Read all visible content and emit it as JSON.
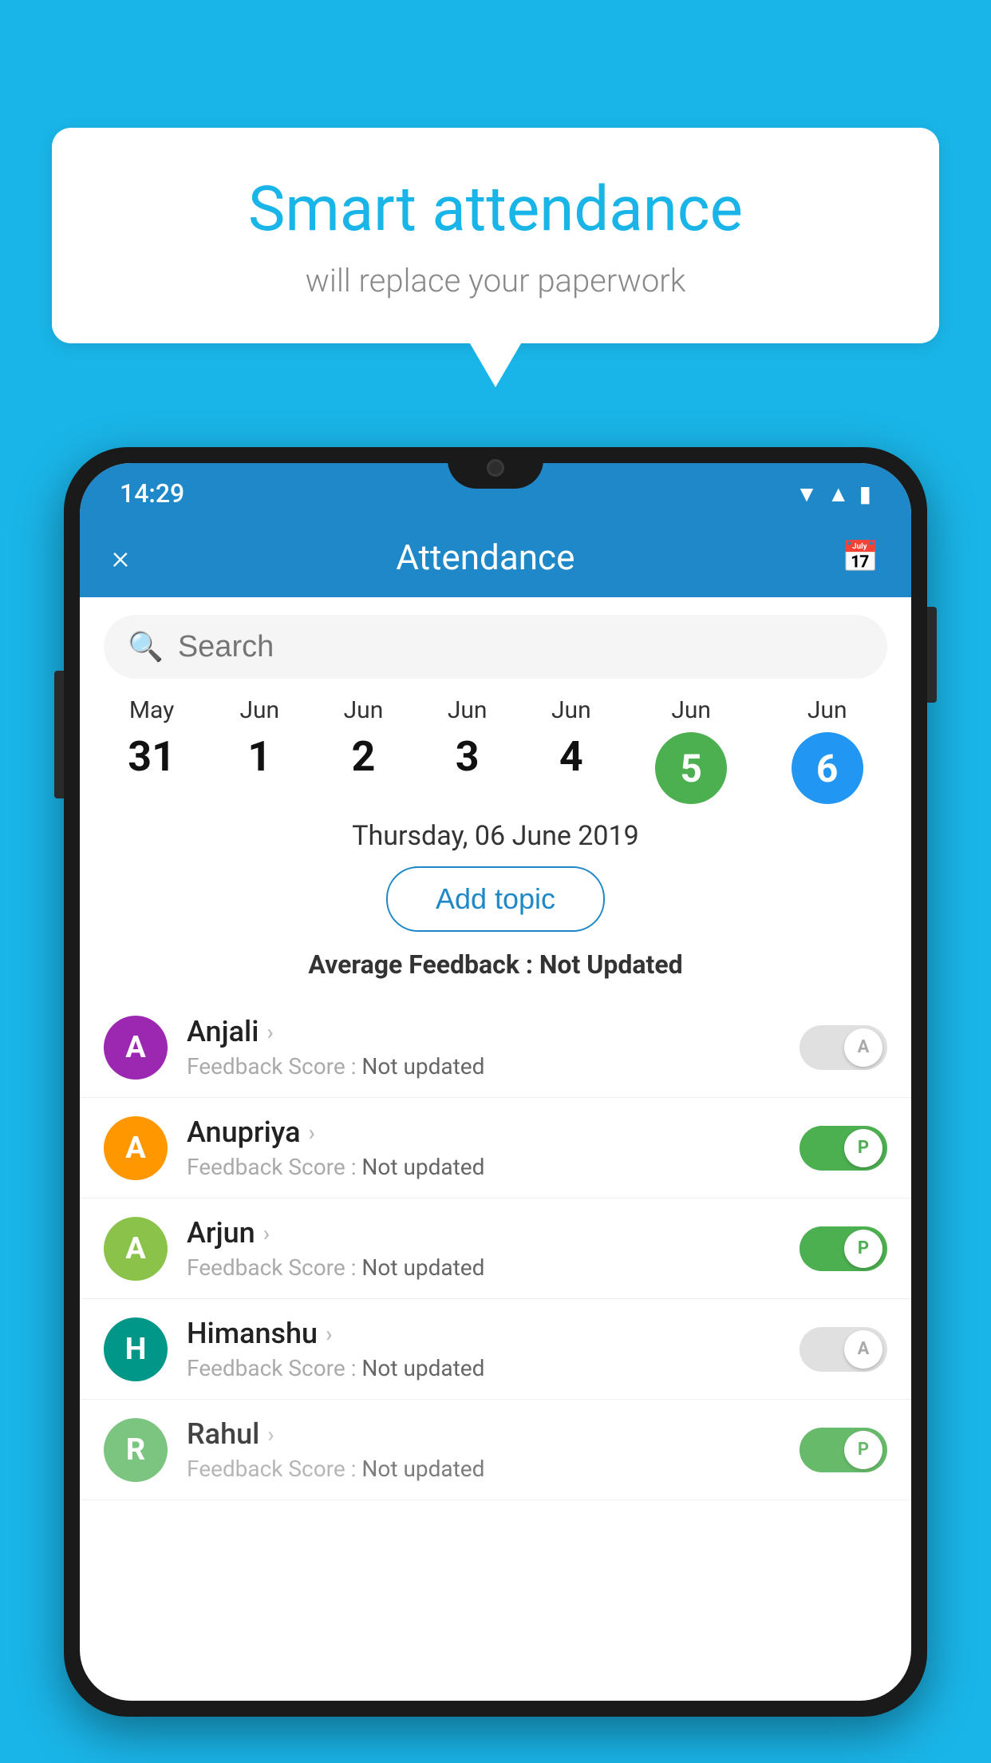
{
  "background_color": "#1ab5e8",
  "speech_bubble": {
    "title": "Smart attendance",
    "subtitle": "will replace your paperwork"
  },
  "status_bar": {
    "time": "14:29",
    "icons": [
      "wifi",
      "signal",
      "battery"
    ]
  },
  "header": {
    "title": "Attendance",
    "close_label": "×",
    "calendar_icon": "calendar"
  },
  "search": {
    "placeholder": "Search"
  },
  "dates": [
    {
      "month": "May",
      "day": "31",
      "type": "plain"
    },
    {
      "month": "Jun",
      "day": "1",
      "type": "plain"
    },
    {
      "month": "Jun",
      "day": "2",
      "type": "plain"
    },
    {
      "month": "Jun",
      "day": "3",
      "type": "plain"
    },
    {
      "month": "Jun",
      "day": "4",
      "type": "plain"
    },
    {
      "month": "Jun",
      "day": "5",
      "type": "green"
    },
    {
      "month": "Jun",
      "day": "6",
      "type": "blue"
    }
  ],
  "selected_date": "Thursday, 06 June 2019",
  "add_topic_label": "Add topic",
  "avg_feedback": {
    "label": "Average Feedback :",
    "value": "Not Updated"
  },
  "students": [
    {
      "name": "Anjali",
      "initial": "A",
      "avatar_color": "purple",
      "feedback_label": "Feedback Score :",
      "feedback_value": "Not updated",
      "toggle": "off",
      "toggle_letter": "A"
    },
    {
      "name": "Anupriya",
      "initial": "A",
      "avatar_color": "orange",
      "feedback_label": "Feedback Score :",
      "feedback_value": "Not updated",
      "toggle": "on",
      "toggle_letter": "P"
    },
    {
      "name": "Arjun",
      "initial": "A",
      "avatar_color": "green-light",
      "feedback_label": "Feedback Score :",
      "feedback_value": "Not updated",
      "toggle": "on",
      "toggle_letter": "P"
    },
    {
      "name": "Himanshu",
      "initial": "H",
      "avatar_color": "teal",
      "feedback_label": "Feedback Score :",
      "feedback_value": "Not updated",
      "toggle": "off",
      "toggle_letter": "A"
    },
    {
      "name": "Rahul",
      "initial": "R",
      "avatar_color": "green2",
      "feedback_label": "Feedback Score :",
      "feedback_value": "Not updated",
      "toggle": "on",
      "toggle_letter": "P"
    }
  ]
}
